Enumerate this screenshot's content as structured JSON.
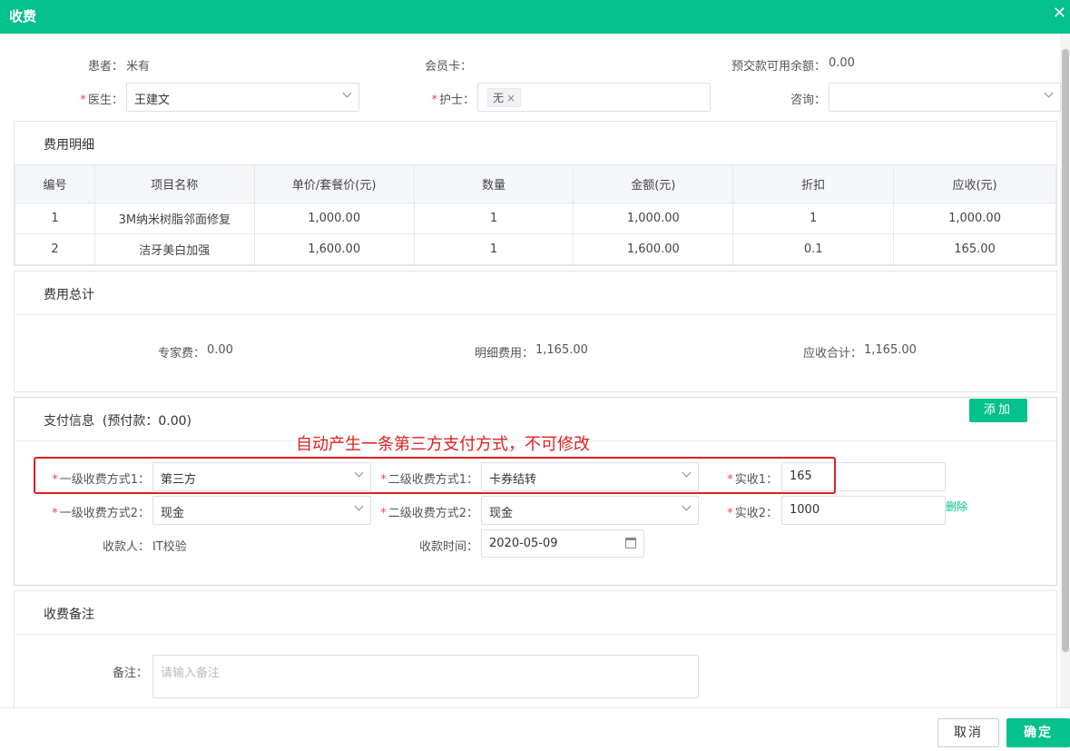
{
  "dialog": {
    "title": "收费",
    "close_icon": "✕"
  },
  "patient": {
    "patient_label": "患者：",
    "patient_value": "米有",
    "member_label": "会员卡：",
    "member_value": "",
    "deposit_label": "预交款可用余额：",
    "deposit_value": "0.00",
    "doctor_label": "医生：",
    "doctor_value": "王建文",
    "nurse_label": "护士：",
    "nurse_tag": "无",
    "consult_label": "咨询：",
    "consult_value": ""
  },
  "fee_detail": {
    "title": "费用明细",
    "columns": [
      "编号",
      "项目名称",
      "单价/套餐价(元)",
      "数量",
      "金额(元)",
      "折扣",
      "应收(元)"
    ],
    "rows": [
      [
        "1",
        "3M纳米树脂邻面修复",
        "1,000.00",
        "1",
        "1,000.00",
        "1",
        "1,000.00"
      ],
      [
        "2",
        "洁牙美白加强",
        "1,600.00",
        "1",
        "1,600.00",
        "0.1",
        "165.00"
      ]
    ]
  },
  "fee_total": {
    "title": "费用总计",
    "expert_label": "专家费：",
    "expert_value": "0.00",
    "detail_label": "明细费用：",
    "detail_value": "1,165.00",
    "receivable_label": "应收合计：",
    "receivable_value": "1,165.00"
  },
  "payment": {
    "title": "支付信息",
    "prepaid_text": "(预付款：0.00)",
    "add_label": "添加",
    "annotation": "自动产生一条第三方支付方式，不可修改",
    "level1_label_1": "一级收费方式1：",
    "level1_value_1": "第三方",
    "level2_label_1": "二级收费方式1：",
    "level2_value_1": "卡券结转",
    "actual_label_1": "实收1：",
    "actual_value_1": "165",
    "level1_label_2": "一级收费方式2：",
    "level1_value_2": "现金",
    "level2_label_2": "二级收费方式2：",
    "level2_value_2": "现金",
    "actual_label_2": "实收2：",
    "actual_value_2": "1000",
    "delete_label": "删除",
    "payee_label": "收款人：",
    "payee_value": "IT校验",
    "date_label": "收款时间：",
    "date_value": "2020-05-09"
  },
  "remark": {
    "title": "收费备注",
    "label": "备注：",
    "placeholder": "请输入备注"
  },
  "footer": {
    "cancel_label": "取消",
    "ok_label": "确定"
  },
  "colors": {
    "accent": "#05c18c",
    "annotation": "#e01f1f",
    "required": "#f04848"
  }
}
